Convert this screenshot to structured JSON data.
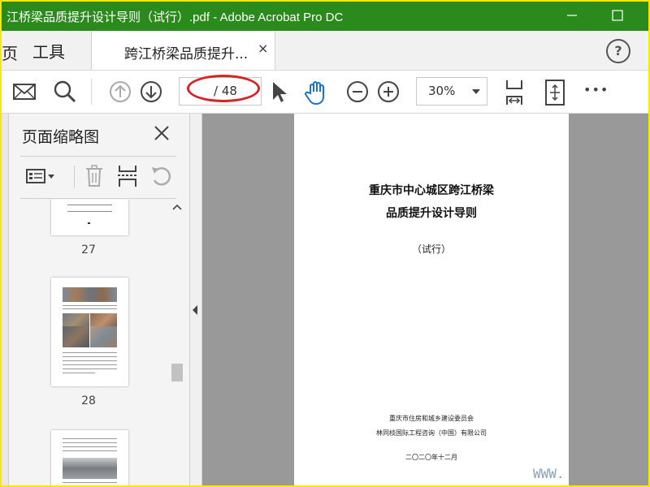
{
  "window": {
    "title": "江桥梁品质提升设计导则（试行）.pdf - Adobe Acrobat Pro DC",
    "minimize_label": "—",
    "maximize_label": "☐"
  },
  "tabs": {
    "home_partial": "页",
    "tools": "工具",
    "document": "跨江桥梁品质提升...",
    "close": "×",
    "help": "?"
  },
  "toolbar": {
    "page_current": "",
    "page_total": "/ 48",
    "zoom": "30%",
    "more": "•••"
  },
  "panel": {
    "title": "页面缩略图",
    "thumbnails": [
      {
        "page": "27"
      },
      {
        "page": "28"
      }
    ]
  },
  "document_page": {
    "title_line1": "重庆市中心城区跨江桥梁",
    "title_line2": "品质提升设计导则",
    "subtitle": "（试行）",
    "issuer1": "重庆市住房和城乡建设委员会",
    "issuer2": "林同棪国际工程咨询（中国）有限公司",
    "date": "二〇二〇年十二月"
  },
  "watermark": "WWW.",
  "colors": {
    "titlebar": "#2b8a1c",
    "highlight_ring": "#d62424",
    "hand_tool": "#1a73c9",
    "doc_background": "#999999"
  }
}
